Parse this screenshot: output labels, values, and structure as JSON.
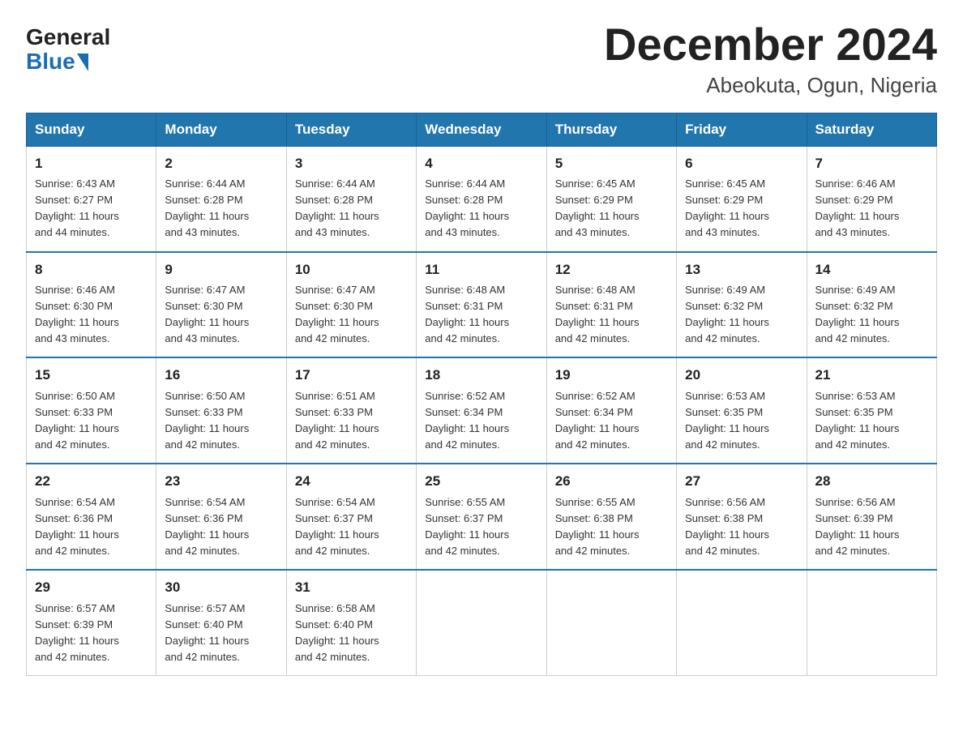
{
  "logo": {
    "general": "General",
    "blue": "Blue"
  },
  "header": {
    "month": "December 2024",
    "location": "Abeokuta, Ogun, Nigeria"
  },
  "days_of_week": [
    "Sunday",
    "Monday",
    "Tuesday",
    "Wednesday",
    "Thursday",
    "Friday",
    "Saturday"
  ],
  "weeks": [
    [
      {
        "day": "1",
        "sunrise": "6:43 AM",
        "sunset": "6:27 PM",
        "daylight": "11 hours and 44 minutes."
      },
      {
        "day": "2",
        "sunrise": "6:44 AM",
        "sunset": "6:28 PM",
        "daylight": "11 hours and 43 minutes."
      },
      {
        "day": "3",
        "sunrise": "6:44 AM",
        "sunset": "6:28 PM",
        "daylight": "11 hours and 43 minutes."
      },
      {
        "day": "4",
        "sunrise": "6:44 AM",
        "sunset": "6:28 PM",
        "daylight": "11 hours and 43 minutes."
      },
      {
        "day": "5",
        "sunrise": "6:45 AM",
        "sunset": "6:29 PM",
        "daylight": "11 hours and 43 minutes."
      },
      {
        "day": "6",
        "sunrise": "6:45 AM",
        "sunset": "6:29 PM",
        "daylight": "11 hours and 43 minutes."
      },
      {
        "day": "7",
        "sunrise": "6:46 AM",
        "sunset": "6:29 PM",
        "daylight": "11 hours and 43 minutes."
      }
    ],
    [
      {
        "day": "8",
        "sunrise": "6:46 AM",
        "sunset": "6:30 PM",
        "daylight": "11 hours and 43 minutes."
      },
      {
        "day": "9",
        "sunrise": "6:47 AM",
        "sunset": "6:30 PM",
        "daylight": "11 hours and 43 minutes."
      },
      {
        "day": "10",
        "sunrise": "6:47 AM",
        "sunset": "6:30 PM",
        "daylight": "11 hours and 42 minutes."
      },
      {
        "day": "11",
        "sunrise": "6:48 AM",
        "sunset": "6:31 PM",
        "daylight": "11 hours and 42 minutes."
      },
      {
        "day": "12",
        "sunrise": "6:48 AM",
        "sunset": "6:31 PM",
        "daylight": "11 hours and 42 minutes."
      },
      {
        "day": "13",
        "sunrise": "6:49 AM",
        "sunset": "6:32 PM",
        "daylight": "11 hours and 42 minutes."
      },
      {
        "day": "14",
        "sunrise": "6:49 AM",
        "sunset": "6:32 PM",
        "daylight": "11 hours and 42 minutes."
      }
    ],
    [
      {
        "day": "15",
        "sunrise": "6:50 AM",
        "sunset": "6:33 PM",
        "daylight": "11 hours and 42 minutes."
      },
      {
        "day": "16",
        "sunrise": "6:50 AM",
        "sunset": "6:33 PM",
        "daylight": "11 hours and 42 minutes."
      },
      {
        "day": "17",
        "sunrise": "6:51 AM",
        "sunset": "6:33 PM",
        "daylight": "11 hours and 42 minutes."
      },
      {
        "day": "18",
        "sunrise": "6:52 AM",
        "sunset": "6:34 PM",
        "daylight": "11 hours and 42 minutes."
      },
      {
        "day": "19",
        "sunrise": "6:52 AM",
        "sunset": "6:34 PM",
        "daylight": "11 hours and 42 minutes."
      },
      {
        "day": "20",
        "sunrise": "6:53 AM",
        "sunset": "6:35 PM",
        "daylight": "11 hours and 42 minutes."
      },
      {
        "day": "21",
        "sunrise": "6:53 AM",
        "sunset": "6:35 PM",
        "daylight": "11 hours and 42 minutes."
      }
    ],
    [
      {
        "day": "22",
        "sunrise": "6:54 AM",
        "sunset": "6:36 PM",
        "daylight": "11 hours and 42 minutes."
      },
      {
        "day": "23",
        "sunrise": "6:54 AM",
        "sunset": "6:36 PM",
        "daylight": "11 hours and 42 minutes."
      },
      {
        "day": "24",
        "sunrise": "6:54 AM",
        "sunset": "6:37 PM",
        "daylight": "11 hours and 42 minutes."
      },
      {
        "day": "25",
        "sunrise": "6:55 AM",
        "sunset": "6:37 PM",
        "daylight": "11 hours and 42 minutes."
      },
      {
        "day": "26",
        "sunrise": "6:55 AM",
        "sunset": "6:38 PM",
        "daylight": "11 hours and 42 minutes."
      },
      {
        "day": "27",
        "sunrise": "6:56 AM",
        "sunset": "6:38 PM",
        "daylight": "11 hours and 42 minutes."
      },
      {
        "day": "28",
        "sunrise": "6:56 AM",
        "sunset": "6:39 PM",
        "daylight": "11 hours and 42 minutes."
      }
    ],
    [
      {
        "day": "29",
        "sunrise": "6:57 AM",
        "sunset": "6:39 PM",
        "daylight": "11 hours and 42 minutes."
      },
      {
        "day": "30",
        "sunrise": "6:57 AM",
        "sunset": "6:40 PM",
        "daylight": "11 hours and 42 minutes."
      },
      {
        "day": "31",
        "sunrise": "6:58 AM",
        "sunset": "6:40 PM",
        "daylight": "11 hours and 42 minutes."
      },
      null,
      null,
      null,
      null
    ]
  ],
  "labels": {
    "sunrise": "Sunrise:",
    "sunset": "Sunset:",
    "daylight": "Daylight:"
  }
}
